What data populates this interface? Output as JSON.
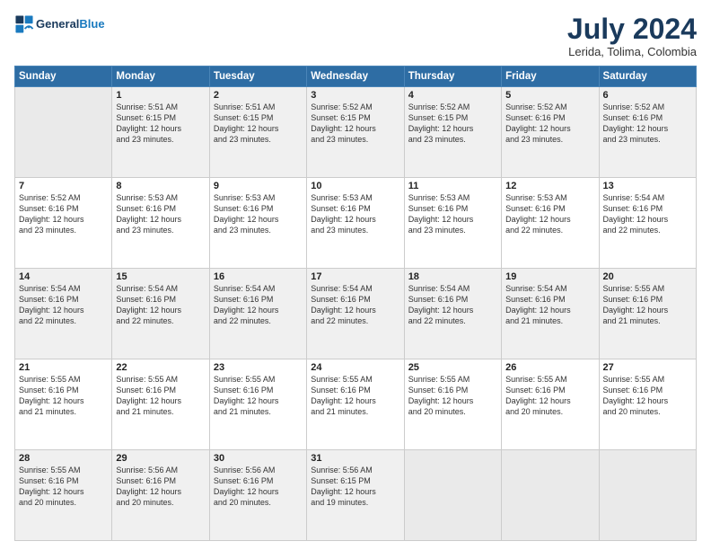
{
  "header": {
    "logo_line1": "General",
    "logo_line2": "Blue",
    "month_year": "July 2024",
    "location": "Lerida, Tolima, Colombia"
  },
  "weekdays": [
    "Sunday",
    "Monday",
    "Tuesday",
    "Wednesday",
    "Thursday",
    "Friday",
    "Saturday"
  ],
  "weeks": [
    [
      {
        "day": "",
        "empty": true
      },
      {
        "day": "1",
        "rise": "5:51 AM",
        "set": "6:15 PM",
        "hours": "12 hours and 23 minutes."
      },
      {
        "day": "2",
        "rise": "5:51 AM",
        "set": "6:15 PM",
        "hours": "12 hours and 23 minutes."
      },
      {
        "day": "3",
        "rise": "5:52 AM",
        "set": "6:15 PM",
        "hours": "12 hours and 23 minutes."
      },
      {
        "day": "4",
        "rise": "5:52 AM",
        "set": "6:15 PM",
        "hours": "12 hours and 23 minutes."
      },
      {
        "day": "5",
        "rise": "5:52 AM",
        "set": "6:16 PM",
        "hours": "12 hours and 23 minutes."
      },
      {
        "day": "6",
        "rise": "5:52 AM",
        "set": "6:16 PM",
        "hours": "12 hours and 23 minutes."
      }
    ],
    [
      {
        "day": "7",
        "rise": "5:52 AM",
        "set": "6:16 PM",
        "hours": "12 hours and 23 minutes."
      },
      {
        "day": "8",
        "rise": "5:53 AM",
        "set": "6:16 PM",
        "hours": "12 hours and 23 minutes."
      },
      {
        "day": "9",
        "rise": "5:53 AM",
        "set": "6:16 PM",
        "hours": "12 hours and 23 minutes."
      },
      {
        "day": "10",
        "rise": "5:53 AM",
        "set": "6:16 PM",
        "hours": "12 hours and 23 minutes."
      },
      {
        "day": "11",
        "rise": "5:53 AM",
        "set": "6:16 PM",
        "hours": "12 hours and 23 minutes."
      },
      {
        "day": "12",
        "rise": "5:53 AM",
        "set": "6:16 PM",
        "hours": "12 hours and 22 minutes."
      },
      {
        "day": "13",
        "rise": "5:54 AM",
        "set": "6:16 PM",
        "hours": "12 hours and 22 minutes."
      }
    ],
    [
      {
        "day": "14",
        "rise": "5:54 AM",
        "set": "6:16 PM",
        "hours": "12 hours and 22 minutes."
      },
      {
        "day": "15",
        "rise": "5:54 AM",
        "set": "6:16 PM",
        "hours": "12 hours and 22 minutes."
      },
      {
        "day": "16",
        "rise": "5:54 AM",
        "set": "6:16 PM",
        "hours": "12 hours and 22 minutes."
      },
      {
        "day": "17",
        "rise": "5:54 AM",
        "set": "6:16 PM",
        "hours": "12 hours and 22 minutes."
      },
      {
        "day": "18",
        "rise": "5:54 AM",
        "set": "6:16 PM",
        "hours": "12 hours and 22 minutes."
      },
      {
        "day": "19",
        "rise": "5:54 AM",
        "set": "6:16 PM",
        "hours": "12 hours and 21 minutes."
      },
      {
        "day": "20",
        "rise": "5:55 AM",
        "set": "6:16 PM",
        "hours": "12 hours and 21 minutes."
      }
    ],
    [
      {
        "day": "21",
        "rise": "5:55 AM",
        "set": "6:16 PM",
        "hours": "12 hours and 21 minutes."
      },
      {
        "day": "22",
        "rise": "5:55 AM",
        "set": "6:16 PM",
        "hours": "12 hours and 21 minutes."
      },
      {
        "day": "23",
        "rise": "5:55 AM",
        "set": "6:16 PM",
        "hours": "12 hours and 21 minutes."
      },
      {
        "day": "24",
        "rise": "5:55 AM",
        "set": "6:16 PM",
        "hours": "12 hours and 21 minutes."
      },
      {
        "day": "25",
        "rise": "5:55 AM",
        "set": "6:16 PM",
        "hours": "12 hours and 20 minutes."
      },
      {
        "day": "26",
        "rise": "5:55 AM",
        "set": "6:16 PM",
        "hours": "12 hours and 20 minutes."
      },
      {
        "day": "27",
        "rise": "5:55 AM",
        "set": "6:16 PM",
        "hours": "12 hours and 20 minutes."
      }
    ],
    [
      {
        "day": "28",
        "rise": "5:55 AM",
        "set": "6:16 PM",
        "hours": "12 hours and 20 minutes."
      },
      {
        "day": "29",
        "rise": "5:56 AM",
        "set": "6:16 PM",
        "hours": "12 hours and 20 minutes."
      },
      {
        "day": "30",
        "rise": "5:56 AM",
        "set": "6:16 PM",
        "hours": "12 hours and 20 minutes."
      },
      {
        "day": "31",
        "rise": "5:56 AM",
        "set": "6:15 PM",
        "hours": "12 hours and 19 minutes."
      },
      {
        "day": "",
        "empty": true
      },
      {
        "day": "",
        "empty": true
      },
      {
        "day": "",
        "empty": true
      }
    ]
  ],
  "labels": {
    "sunrise": "Sunrise:",
    "sunset": "Sunset:",
    "daylight": "Daylight:"
  }
}
